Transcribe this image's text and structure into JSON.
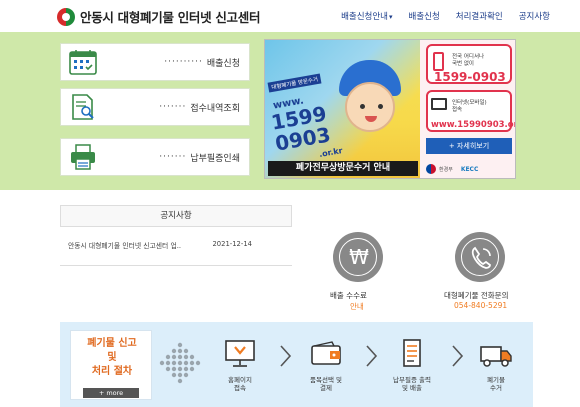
{
  "header": {
    "site_title": "안동시 대형폐기물 인터넷 신고센터",
    "nav": [
      {
        "label": "배출신청안내",
        "has_dropdown": true
      },
      {
        "label": "배출신청",
        "has_dropdown": false
      },
      {
        "label": "처리결과확인",
        "has_dropdown": false
      },
      {
        "label": "공지사항",
        "has_dropdown": false
      }
    ],
    "dropdown_caret": "▾"
  },
  "quick_links": [
    {
      "dots": "··········",
      "label": "배출신청",
      "icon": "calendar-icon"
    },
    {
      "dots": "·······",
      "label": "접수내역조회",
      "icon": "document-search-icon"
    },
    {
      "dots": "·······",
      "label": "납부필증인쇄",
      "icon": "printer-icon"
    }
  ],
  "banner": {
    "tag": "대형폐기물 방문수거",
    "www": "www.",
    "number_line1": "1599",
    "number_line2": "0903",
    "domain": ".or.kr",
    "caption": "폐가전무상방문수거 안내",
    "phone_box": {
      "line1": "전국 어디서나",
      "line2": "국번 없이",
      "number": "1599-0903"
    },
    "web_box": {
      "line1": "인터넷(모바일)",
      "line2": "접속",
      "url": "www.15990903.or.kr"
    },
    "detail_button": "+ 자세히보기",
    "footer_ministry": "환경부",
    "footer_keco": "KECC"
  },
  "notice": {
    "title": "공지사항",
    "items": [
      {
        "title": "안동시 대형폐기물 인터넷 신고센터 업..",
        "date": "2021-12-14"
      }
    ]
  },
  "services": {
    "fee": {
      "symbol": "₩",
      "label": "배출 수수료",
      "sub": "안내",
      "icon": "won-icon"
    },
    "phone": {
      "label": "대형폐기물 전화문의",
      "sub": "054-840-5291",
      "icon": "phone-icon"
    }
  },
  "process": {
    "title_lines": [
      "폐기물 신고",
      "및",
      "처리 절차"
    ],
    "more_label": "+ more",
    "steps": [
      {
        "line1": "홈페이지",
        "line2": "접속",
        "icon": "monitor-icon"
      },
      {
        "line1": "품목선택 및",
        "line2": "결제",
        "icon": "wallet-icon"
      },
      {
        "line1": "납부필증 출력",
        "line2": "및 배출",
        "icon": "receipt-icon"
      },
      {
        "line1": "폐기물",
        "line2": "수거",
        "icon": "truck-icon"
      }
    ]
  },
  "colors": {
    "hero_bg": "#cfe8a9",
    "nav_text": "#1c3d8a",
    "accent_orange": "#f07c22",
    "banner_red": "#e1334d",
    "process_bg": "#dceefa"
  }
}
